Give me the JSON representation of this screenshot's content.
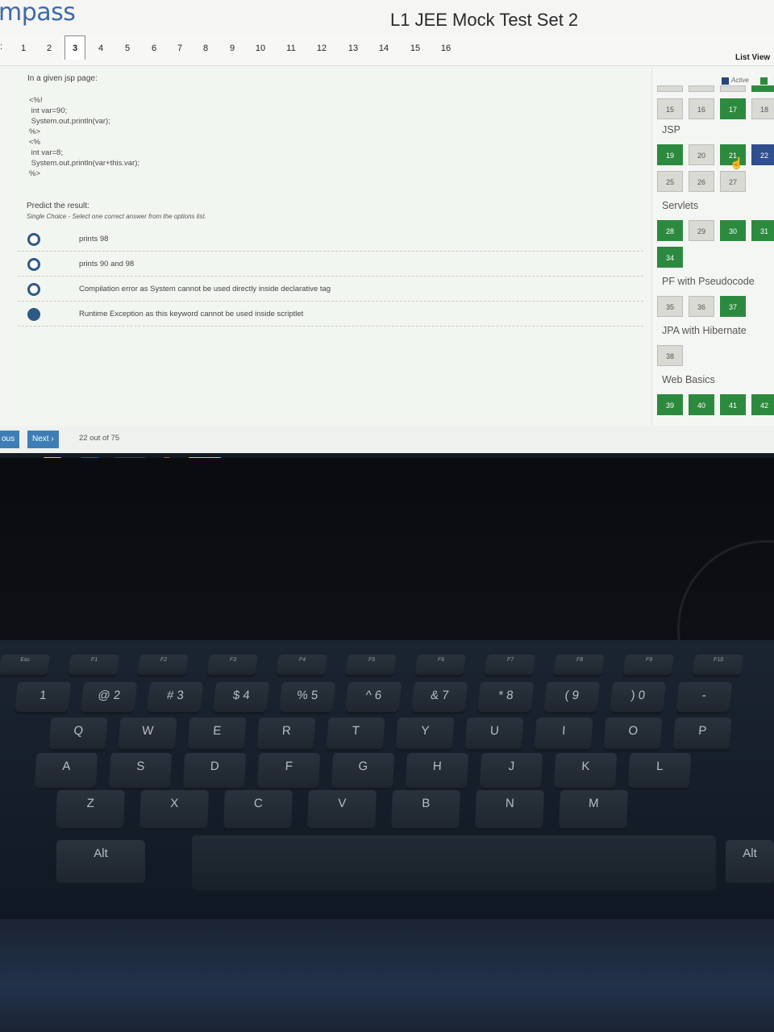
{
  "app": {
    "logo_text": "mpass",
    "title": "L1 JEE Mock Test Set 2"
  },
  "question_nav": {
    "prefix": ":",
    "numbers": [
      "1",
      "2",
      "3",
      "4",
      "5",
      "6",
      "7",
      "8",
      "9",
      "10",
      "11",
      "12",
      "13",
      "14",
      "15",
      "16"
    ],
    "active": "3",
    "list_view_label": "List View"
  },
  "question": {
    "prompt": "In a given jsp page:",
    "code": "<%!\n int var=90;\n System.out.println(var);\n%>\n<%\n int var=8;\n System.out.println(var+this.var);\n%>",
    "instruction": "Predict the result:",
    "answer_type": "Single Choice - Select one correct answer from the options list.",
    "options": [
      {
        "text": "prints 98",
        "selected": false
      },
      {
        "text": "prints 90 and 98",
        "selected": false
      },
      {
        "text": "Compilation error as System cannot be used directly inside declarative tag",
        "selected": false
      },
      {
        "text": "Runtime Exception as this keyword cannot be used inside scriptlet",
        "selected": true
      }
    ]
  },
  "palette": {
    "legend_active": "Active",
    "top_row": [
      {
        "num": "15",
        "state": "not-answered"
      },
      {
        "num": "16",
        "state": "not-answered"
      },
      {
        "num": "17",
        "state": "answered"
      },
      {
        "num": "18",
        "state": "not-answered"
      }
    ],
    "sections": [
      {
        "name": "JSP",
        "rows": [
          [
            {
              "num": "19",
              "state": "answered"
            },
            {
              "num": "20",
              "state": "not-answered"
            },
            {
              "num": "21",
              "state": "answered"
            },
            {
              "num": "22",
              "state": "current"
            }
          ],
          [
            {
              "num": "25",
              "state": "not-answered"
            },
            {
              "num": "26",
              "state": "not-answered"
            },
            {
              "num": "27",
              "state": "not-answered"
            }
          ]
        ]
      },
      {
        "name": "Servlets",
        "rows": [
          [
            {
              "num": "28",
              "state": "answered"
            },
            {
              "num": "29",
              "state": "not-answered"
            },
            {
              "num": "30",
              "state": "answered"
            },
            {
              "num": "31",
              "state": "answered"
            }
          ],
          [
            {
              "num": "34",
              "state": "answered"
            }
          ]
        ]
      },
      {
        "name": "PF with Pseudocode",
        "rows": [
          [
            {
              "num": "35",
              "state": "not-answered"
            },
            {
              "num": "36",
              "state": "not-answered"
            },
            {
              "num": "37",
              "state": "answered"
            }
          ]
        ]
      },
      {
        "name": "JPA with Hibernate",
        "rows": [
          [
            {
              "num": "38",
              "state": "not-answered"
            }
          ]
        ]
      },
      {
        "name": "Web Basics",
        "rows": [
          [
            {
              "num": "39",
              "state": "answered"
            },
            {
              "num": "40",
              "state": "answered"
            },
            {
              "num": "41",
              "state": "answered"
            },
            {
              "num": "42",
              "state": "answered"
            }
          ]
        ]
      }
    ]
  },
  "footer": {
    "previous_label": "ous",
    "next_label": "Next ›",
    "progress": "22 out of 75"
  },
  "taskbar": {
    "icons": [
      "ie-icon",
      "file-explorer-icon",
      "media-player-icon",
      "chrome-icon",
      "firefox-icon",
      "warning-icon"
    ]
  },
  "keyboard": {
    "function_keys": [
      "Esc",
      "F1",
      "F2",
      "F3",
      "F4",
      "F5",
      "F6",
      "F7",
      "F8",
      "F9",
      "F10"
    ],
    "number_row": [
      "1",
      "@ 2",
      "# 3",
      "$ 4",
      "% 5",
      "^ 6",
      "& 7",
      "* 8",
      "( 9",
      ") 0",
      "-"
    ],
    "qwerty_row": [
      "Q",
      "W",
      "E",
      "R",
      "T",
      "Y",
      "U",
      "I",
      "O",
      "P"
    ],
    "home_row": [
      "A",
      "S",
      "D",
      "F",
      "G",
      "H",
      "J",
      "K",
      "L"
    ],
    "bottom_row": [
      "Z",
      "X",
      "C",
      "V",
      "B",
      "N",
      "M"
    ],
    "modifier_left": "Alt",
    "modifier_right": "Alt"
  }
}
